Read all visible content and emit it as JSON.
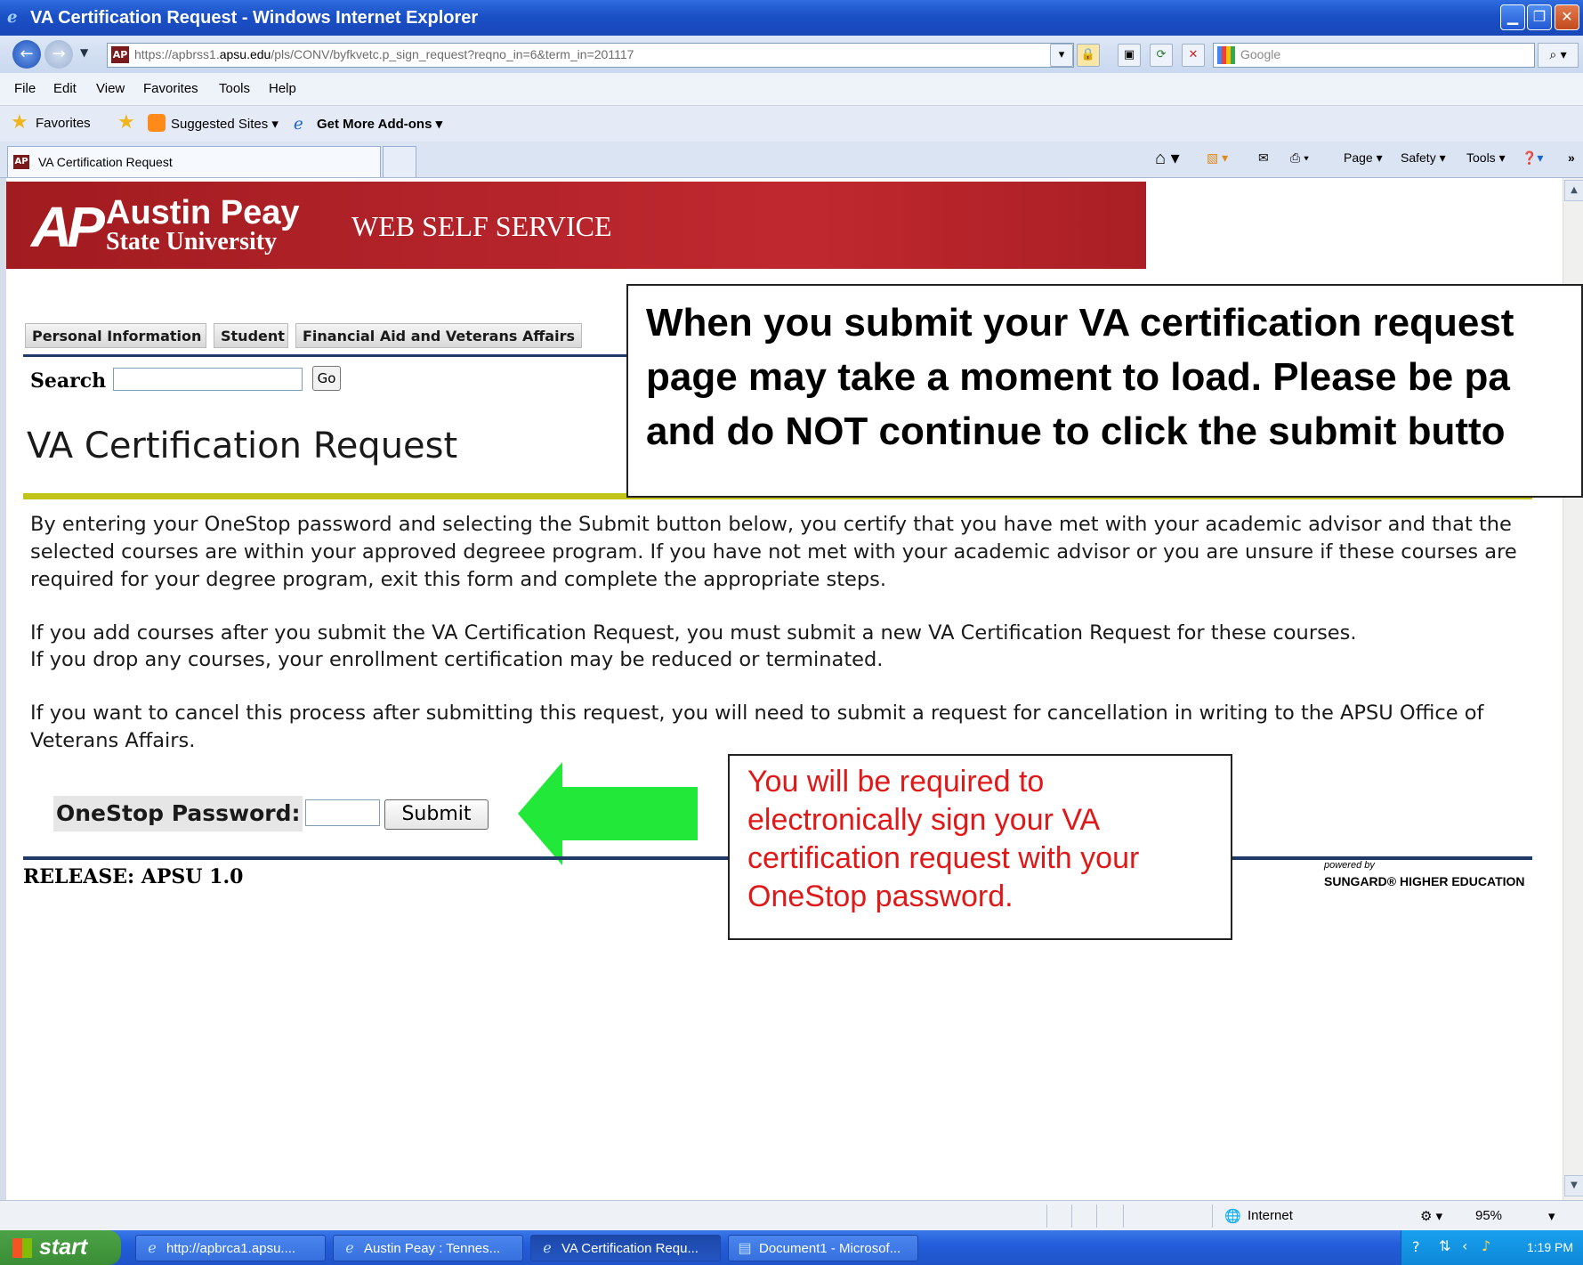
{
  "window": {
    "title": "VA Certification Request - Windows Internet Explorer"
  },
  "address_bar": {
    "url_prefix": "https://apbrss1.",
    "url_domain": "apsu.edu",
    "url_suffix": "/pls/CONV/byfkvetc.p_sign_request?reqno_in=6&term_in=201117"
  },
  "search_box": {
    "placeholder": "Google"
  },
  "menu": [
    "File",
    "Edit",
    "View",
    "Favorites",
    "Tools",
    "Help"
  ],
  "favorites_bar": {
    "favorites": "Favorites",
    "suggested": "Suggested Sites ▾",
    "addons": "Get More Add-ons ▾"
  },
  "browser_tab": {
    "label": "VA Certification Request"
  },
  "command_bar": {
    "page": "Page ▾",
    "safety": "Safety ▾",
    "tools": "Tools ▾"
  },
  "banner": {
    "ap": "AP",
    "line1": "Austin Peay",
    "line2": "State University",
    "service": "WEB SELF SERVICE"
  },
  "page_tabs": [
    "Personal Information",
    "Student",
    "Financial Aid and Veterans Affairs"
  ],
  "search": {
    "label": "Search",
    "go": "Go"
  },
  "page_title": "VA Certification Request",
  "callout": {
    "line1": "When you submit your VA certification request",
    "line2": "page may take a moment to load. Please be pa",
    "line3": "and do NOT continue to click the submit butto"
  },
  "paragraphs": {
    "p1": "By entering your OneStop password and selecting the Submit button below, you certify that you have met with your academic advisor and that the selected courses are within your approved degreee program. If you have not met with your academic advisor or you are unsure if these courses are required for your degree program, exit this form and complete the appropriate steps.",
    "p2a": "If you add courses after you submit the VA Certification Request, you must submit a new VA Certification Request for these courses.",
    "p2b": "If you drop any courses, your enrollment certification may be reduced or terminated.",
    "p3": "If you want to cancel this process after submitting this request, you will need to submit a request for cancellation in writing to the APSU Office of Veterans Affairs."
  },
  "password": {
    "label": "OneStop Password:",
    "submit": "Submit"
  },
  "red_callout": {
    "line1": "You will be required to",
    "line2": "electronically sign your VA",
    "line3": "certification request with your",
    "line4": "OneStop password."
  },
  "release": "RELEASE: APSU 1.0",
  "vendor": {
    "powered": "powered by",
    "name": "SUNGARD® HIGHER EDUCATION"
  },
  "status_bar": {
    "zone": "Internet",
    "zoom": "95%"
  },
  "taskbar": {
    "start": "start",
    "items": [
      "http://apbrca1.apsu....",
      "Austin Peay : Tennes...",
      "VA Certification Requ...",
      "Document1 - Microsof..."
    ],
    "clock": "1:19 PM"
  },
  "colors": {
    "banner_red": "#b3232a",
    "arrow_green": "#22e83a",
    "callout_red": "#e01818",
    "accent_olive": "#c3c41a"
  }
}
